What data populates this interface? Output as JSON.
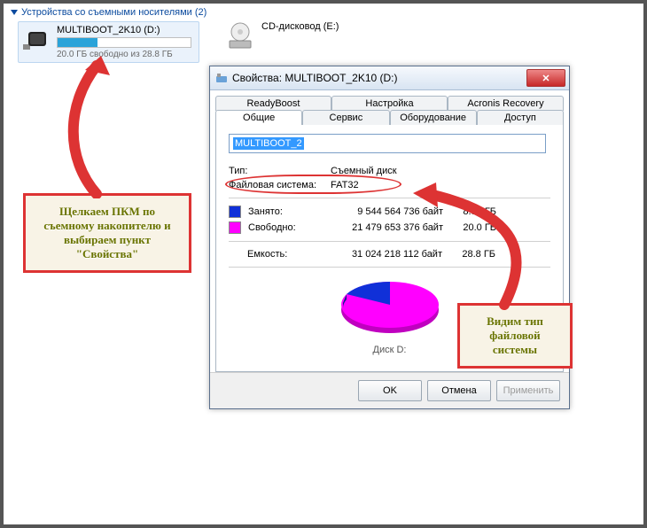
{
  "section": {
    "title": "Устройства со съемными носителями (2)"
  },
  "devices": {
    "usb": {
      "name": "MULTIBOOT_2K10 (D:)",
      "free": "20.0 ГБ свободно из 28.8 ГБ",
      "fill_pct": 30
    },
    "cd": {
      "name": "CD-дисковод (E:)"
    }
  },
  "dialog": {
    "title": "Свойства: MULTIBOOT_2K10 (D:)",
    "tabs_upper": [
      "ReadyBoost",
      "Настройка",
      "Acronis Recovery"
    ],
    "tabs_lower": [
      "Общие",
      "Сервис",
      "Оборудование",
      "Доступ"
    ],
    "volume_name": "MULTIBOOT_2",
    "type_label": "Тип:",
    "type_value": "Съемный диск",
    "fs_label": "Файловая система:",
    "fs_value": "FAT32",
    "used_label": "Занято:",
    "used_bytes": "9 544 564 736 байт",
    "used_gb": "8.88 ГБ",
    "free_label": "Свободно:",
    "free_bytes": "21 479 653 376 байт",
    "free_gb": "20.0 ГБ",
    "cap_label": "Емкость:",
    "cap_bytes": "31 024 218 112 байт",
    "cap_gb": "28.8 ГБ",
    "disk_label": "Диск D:",
    "ok": "OK",
    "cancel": "Отмена",
    "apply": "Применить"
  },
  "callouts": {
    "left": "Щелкаем ПКМ по съемному накопителю и выбираем пункт \"Свойства\"",
    "right": "Видим тип файловой системы"
  },
  "chart_data": {
    "type": "pie",
    "title": "Диск D:",
    "series": [
      {
        "name": "Занято",
        "value": 9544564736,
        "display": "8.88 ГБ",
        "color": "#1030d8"
      },
      {
        "name": "Свободно",
        "value": 21479653376,
        "display": "20.0 ГБ",
        "color": "#ff00ff"
      }
    ],
    "total": {
      "name": "Емкость",
      "value": 31024218112,
      "display": "28.8 ГБ"
    }
  }
}
